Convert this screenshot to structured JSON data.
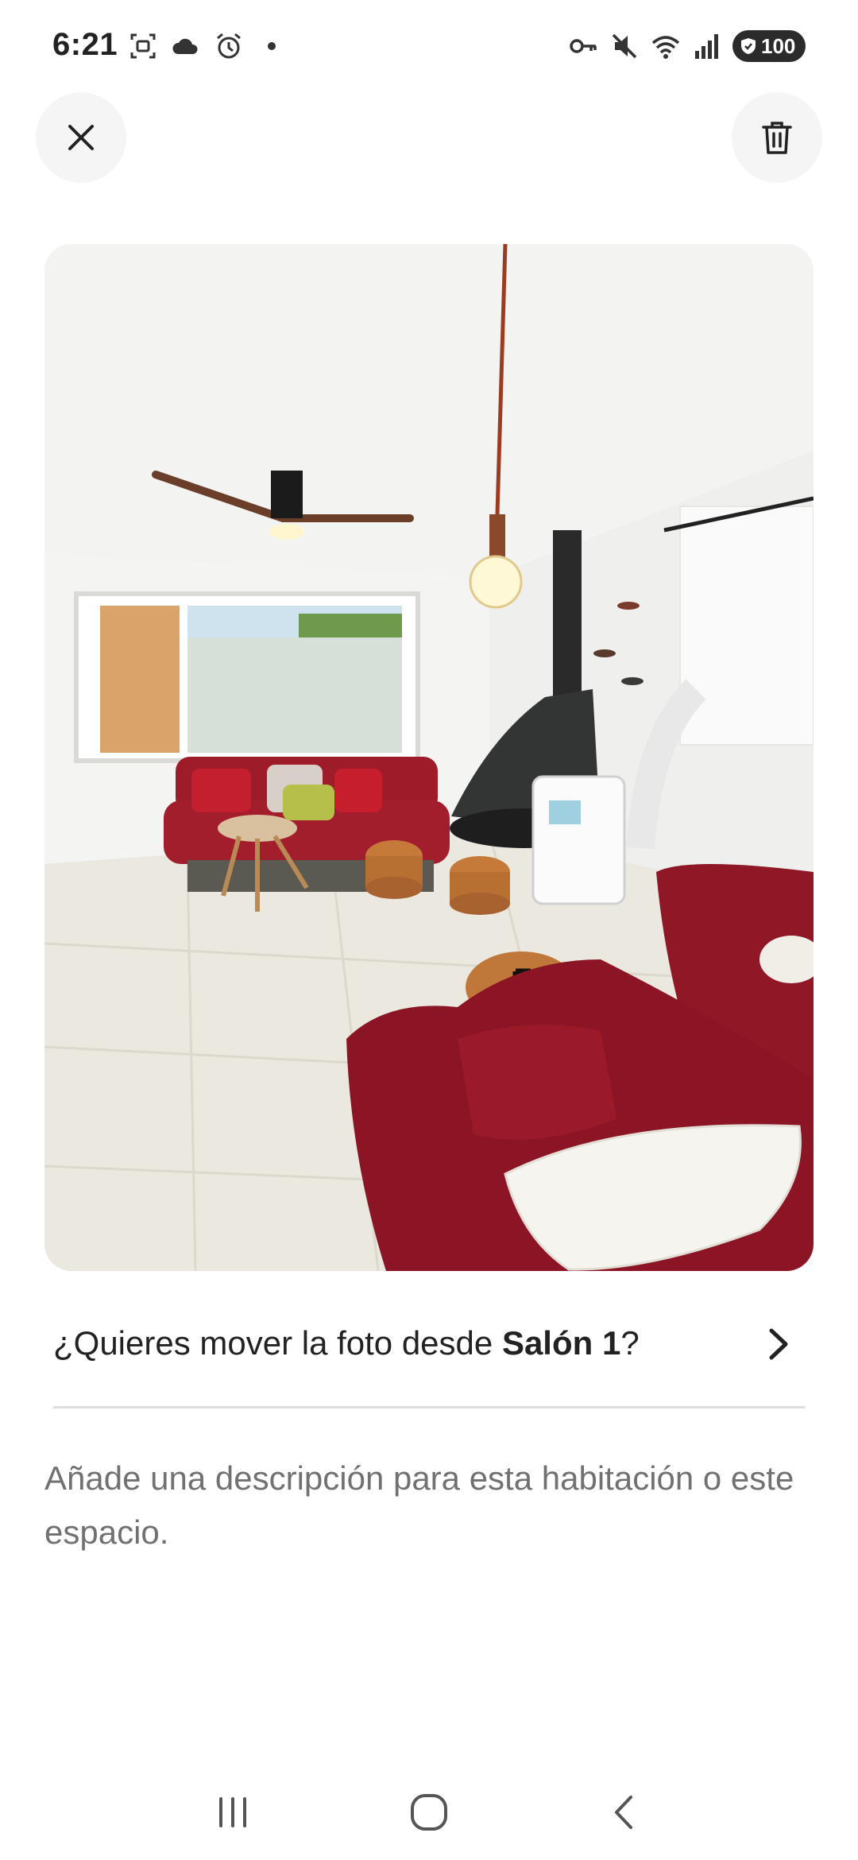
{
  "status_bar": {
    "time": "6:21",
    "battery": "100",
    "left_icons": [
      "screenshot-icon",
      "cloud-icon",
      "alarm-icon",
      "dot-icon"
    ],
    "right_icons": [
      "key-icon",
      "mute-icon",
      "wifi-icon",
      "signal-icon",
      "battery-icon"
    ]
  },
  "toolbar": {
    "close_icon": "close-icon",
    "delete_icon": "trash-icon"
  },
  "photo": {
    "subject": "living-room-photo"
  },
  "move_row": {
    "prefix": "¿Quieres mover la foto desde ",
    "room": "Salón 1",
    "suffix": "?"
  },
  "description": {
    "placeholder": "Añade una descripción para esta habitación o este espacio."
  },
  "nav_bar": {
    "icons": [
      "recents-icon",
      "home-icon",
      "back-icon"
    ]
  },
  "colors": {
    "text_primary": "#222222",
    "text_secondary": "#717171",
    "divider": "#dddddd",
    "button_bg": "#f5f5f5"
  }
}
